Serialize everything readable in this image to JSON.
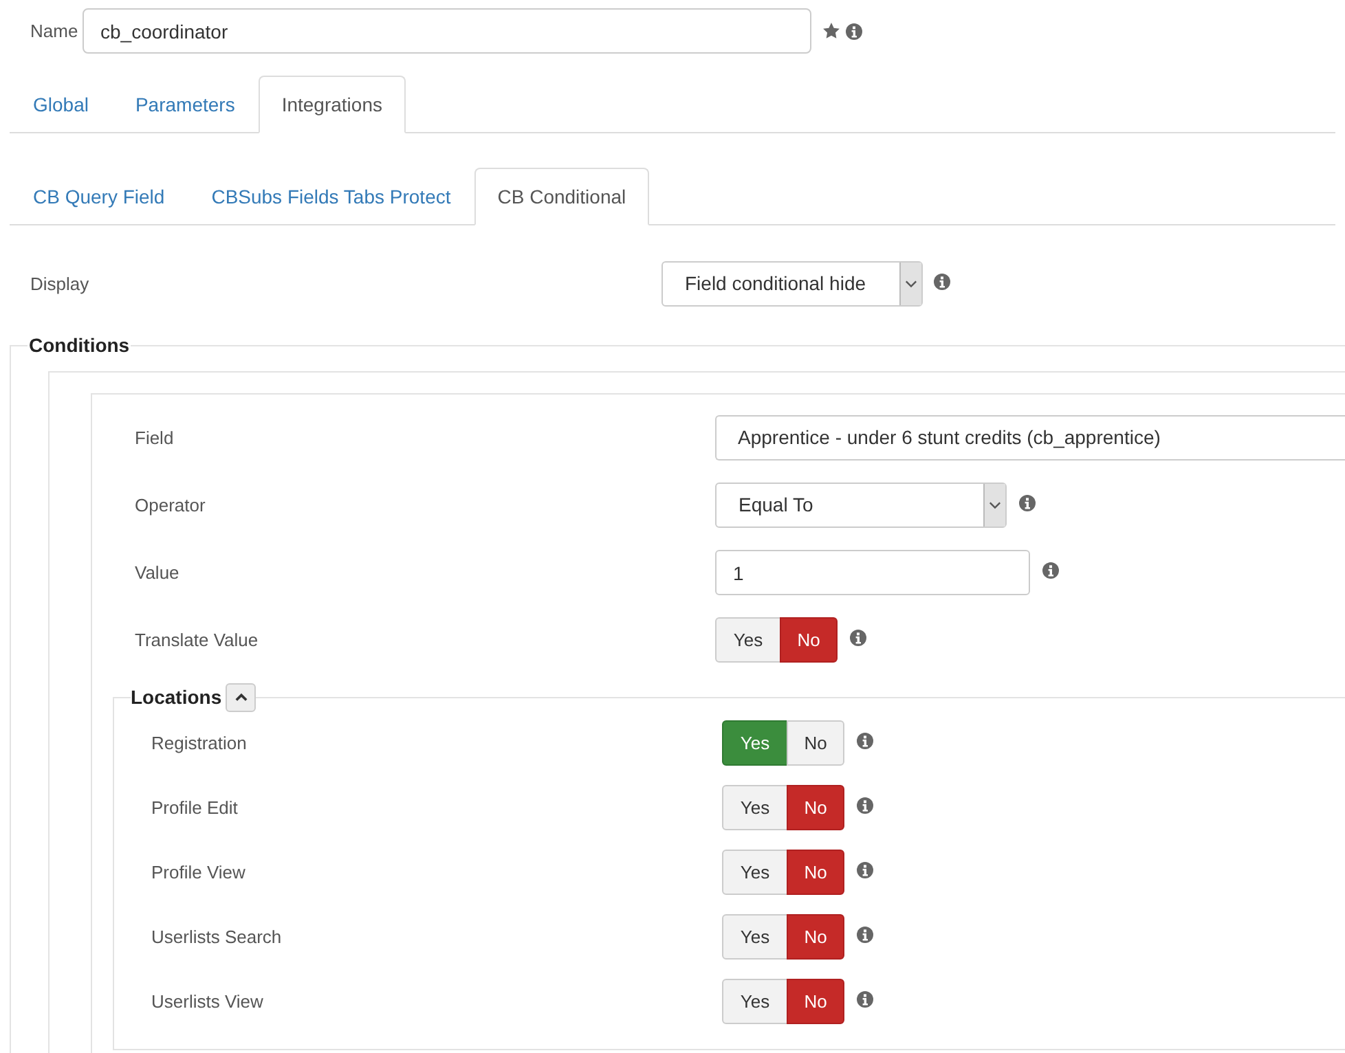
{
  "name_field": {
    "label": "Name",
    "value": "cb_coordinator"
  },
  "tabs": [
    {
      "label": "Global",
      "selected": false
    },
    {
      "label": "Parameters",
      "selected": false
    },
    {
      "label": "Integrations",
      "selected": true
    }
  ],
  "subtabs": [
    {
      "label": "CB Query Field",
      "selected": false
    },
    {
      "label": "CBSubs Fields Tabs Protect",
      "selected": false
    },
    {
      "label": "CB Conditional",
      "selected": true
    }
  ],
  "display": {
    "label": "Display",
    "value": "Field conditional hide"
  },
  "conditions": {
    "legend": "Conditions",
    "field": {
      "label": "Field",
      "value": "Apprentice - under 6 stunt credits (cb_apprentice)"
    },
    "operator": {
      "label": "Operator",
      "value": "Equal To"
    },
    "value": {
      "label": "Value",
      "value": "1"
    },
    "translate_value": {
      "label": "Translate Value",
      "options": [
        {
          "label": "Yes",
          "selected": false
        },
        {
          "label": "No",
          "selected": true
        }
      ]
    },
    "locations": {
      "legend": "Locations",
      "expanded": true,
      "rows": [
        {
          "label": "Registration",
          "options": [
            {
              "label": "Yes",
              "selected": true
            },
            {
              "label": "No",
              "selected": false
            }
          ]
        },
        {
          "label": "Profile Edit",
          "options": [
            {
              "label": "Yes",
              "selected": false
            },
            {
              "label": "No",
              "selected": true
            }
          ]
        },
        {
          "label": "Profile View",
          "options": [
            {
              "label": "Yes",
              "selected": false
            },
            {
              "label": "No",
              "selected": true
            }
          ]
        },
        {
          "label": "Userlists Search",
          "options": [
            {
              "label": "Yes",
              "selected": false
            },
            {
              "label": "No",
              "selected": true
            }
          ]
        },
        {
          "label": "Userlists View",
          "options": [
            {
              "label": "Yes",
              "selected": false
            },
            {
              "label": "No",
              "selected": true
            }
          ]
        }
      ]
    }
  }
}
